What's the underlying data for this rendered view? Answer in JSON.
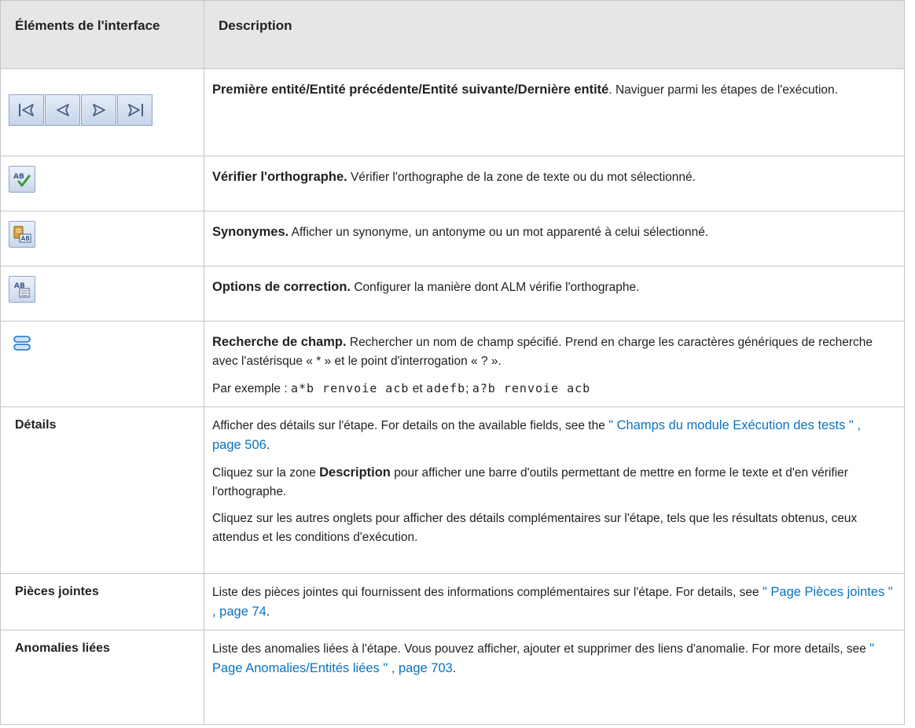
{
  "header": {
    "col1": "Éléments de l'interface",
    "col2": "Description"
  },
  "rows": [
    {
      "icons": [
        "first-entity-icon",
        "previous-entity-icon",
        "next-entity-icon",
        "last-entity-icon"
      ],
      "title": "Première entité/Entité précédente/Entité suivante/Dernière entité",
      "text": ". Naviguer parmi les étapes de l'exécution."
    },
    {
      "icons": [
        "spell-check-icon"
      ],
      "title": "Vérifier l'orthographe.",
      "text": " Vérifier l'orthographe de la zone de texte ou du mot sélectionné."
    },
    {
      "icons": [
        "thesaurus-icon"
      ],
      "title": "Synonymes.",
      "text": " Afficher un synonyme, un antonyme ou un mot apparenté à celui sélectionné."
    },
    {
      "icons": [
        "spelling-options-icon"
      ],
      "title": "Options de correction.",
      "text": " Configurer la manière dont ALM vérifie l'orthographe."
    },
    {
      "icons": [
        "field-search-icon"
      ],
      "title": "Recherche de champ.",
      "text": " Rechercher un nom de champ spécifié. Prend en charge les caractères génériques de recherche avec l'astérisque « * » et le point d'interrogation « ? ».",
      "example_prefix": "Par exemple : ",
      "example_code1": "a*b renvoie acb",
      "example_mid": "  et ",
      "example_code2": "adefb",
      "example_sep": "; ",
      "example_code3": "a?b renvoie acb"
    },
    {
      "label": "Détails",
      "p1_text": "Afficher des détails sur l'étape. For details on the available fields, see the ",
      "p1_link": "\" Champs du module Exécution des tests \" , page 506",
      "p1_end": ".",
      "p2_prefix": "Cliquez sur la zone ",
      "p2_bold": "Description",
      "p2_text": " pour afficher une barre d'outils permettant de mettre en forme le texte et d'en vérifier l'orthographe.",
      "p3": "Cliquez sur les autres onglets pour afficher des détails complémentaires sur l'étape, tels que les résultats obtenus, ceux attendus et les conditions d'exécution."
    },
    {
      "label": "Pièces jointes",
      "text": "Liste des pièces jointes qui fournissent des informations complémentaires sur l'étape. For details, see ",
      "link": "\" Page Pièces jointes \" , page 74",
      "end": "."
    },
    {
      "label": "Anomalies liées",
      "text": "Liste des anomalies liées à l'étape. Vous pouvez afficher, ajouter et supprimer des liens d'anomalie. For more details, see ",
      "link": "\" Page Anomalies/Entités liées \" , page 703",
      "end": "."
    }
  ]
}
